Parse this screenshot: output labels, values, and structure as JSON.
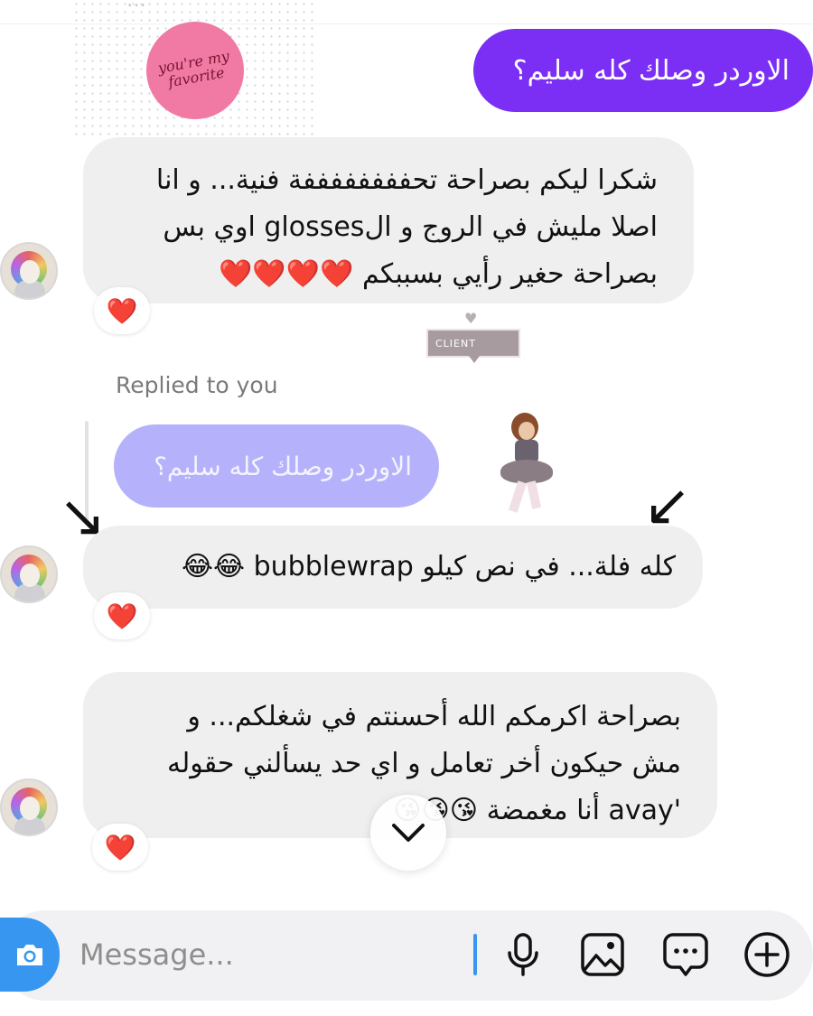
{
  "header": {
    "clipped_text": "…"
  },
  "sticker": {
    "text": "you're my favorite"
  },
  "messages": {
    "outgoing_1": "الاوردر وصلك كله سليم؟",
    "incoming_1_lines": [
      "شكرا ليكم بصراحة تحففففففففة فنية... و انا",
      "اصلا مليش في الروج و الglosses اوي بس",
      "بصراحة حغير رأيي بسببكم ❤️❤️❤️❤️"
    ],
    "incoming_1_reaction": "❤️",
    "client_tag": "CLIENT",
    "replied_label": "Replied to you",
    "reply_quote": "الاوردر وصلك كله سليم؟",
    "incoming_2": "كله فلة... في نص كيلو bubblewrap 😂😂",
    "incoming_2_reaction": "❤️",
    "incoming_3_lines": [
      "بصراحة اكرمكم الله أحسنتم في شغلكم... و",
      "مش حيكون أخر تعامل و اي حد يسألني حقوله",
      "'avay أنا مغمضة 😘😘😘"
    ],
    "incoming_3_reaction": "❤️"
  },
  "composer": {
    "placeholder": "Message...",
    "value": ""
  },
  "icons": {
    "camera": "camera-icon",
    "microphone": "microphone-icon",
    "gallery": "image-icon",
    "sticker": "chat-bubble-icon",
    "add": "plus-circle-icon",
    "scroll_down": "chevron-down-icon"
  },
  "colors": {
    "outgoing_bubble": "#7b2ff4",
    "incoming_bubble": "#efefef",
    "reply_bubble": "#b5b1fb",
    "camera_button": "#3797f0"
  }
}
